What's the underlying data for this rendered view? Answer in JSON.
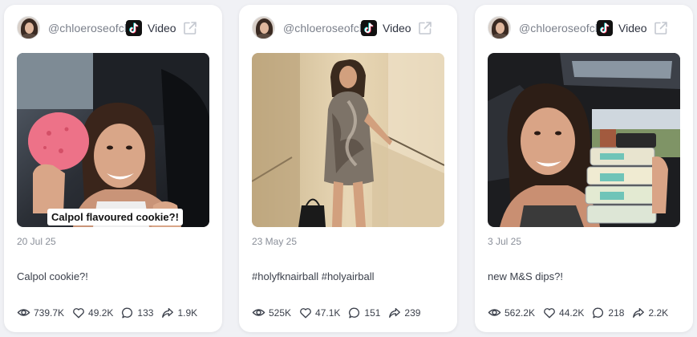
{
  "colors": {
    "page_bg": "#f0f1f5",
    "card_bg": "#ffffff",
    "muted_text": "#7a7f8a",
    "body_text": "#3a3f4a"
  },
  "cards": [
    {
      "username": "@chloeroseofcl",
      "platform_icon": "tiktok-icon",
      "type_label": "Video",
      "thumbnail_caption": "Calpol flavoured cookie?!",
      "date": "20 Jul 25",
      "description": "Calpol cookie?!",
      "stats": {
        "views": "739.7K",
        "likes": "49.2K",
        "comments": "133",
        "shares": "1.9K"
      }
    },
    {
      "username": "@chloeroseofcl",
      "platform_icon": "tiktok-icon",
      "type_label": "Video",
      "date": "23 May 25",
      "description": "#holyfknairball #holyairball",
      "stats": {
        "views": "525K",
        "likes": "47.1K",
        "comments": "151",
        "shares": "239"
      }
    },
    {
      "username": "@chloeroseofcl",
      "platform_icon": "tiktok-icon",
      "type_label": "Video",
      "date": "3 Jul 25",
      "description": "new M&S dips?!",
      "stats": {
        "views": "562.2K",
        "likes": "44.2K",
        "comments": "218",
        "shares": "2.2K"
      }
    }
  ]
}
